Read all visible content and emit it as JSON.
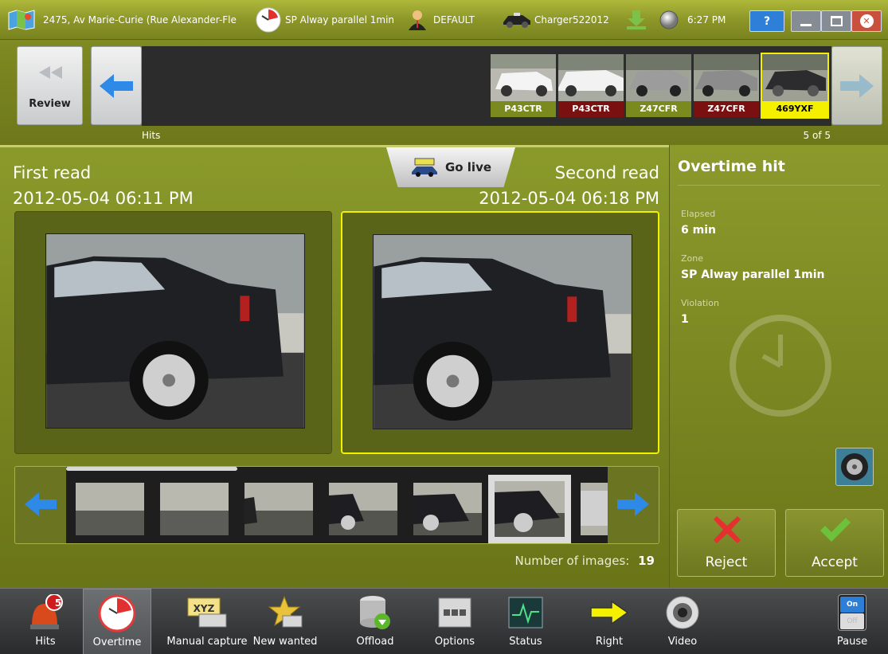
{
  "topbar": {
    "address": "2475, Av Marie-Curie  (Rue Alexander-Fle",
    "zone": "SP Alway parallel 1min",
    "profile": "DEFAULT",
    "vehicle": "Charger522012",
    "time": "6:27 PM",
    "help_label": "?"
  },
  "hits_strip": {
    "review_label": "Review",
    "caption": "Hits",
    "position": "5 of 5",
    "thumbs": [
      {
        "plate": "P43CTR",
        "label_color": "#7a8a1e"
      },
      {
        "plate": "P43CTR",
        "label_color": "#7a1010"
      },
      {
        "plate": "Z47CFR",
        "label_color": "#7a8a1e"
      },
      {
        "plate": "Z47CFR",
        "label_color": "#7a1010"
      },
      {
        "plate": "469YXF",
        "label_color": "#f5f000"
      }
    ]
  },
  "main": {
    "first_read_label": "First read",
    "first_read_date": "2012-05-04 06:11 PM",
    "second_read_label": "Second read",
    "second_read_date": "2012-05-04 06:18 PM",
    "go_live_label": "Go live",
    "number_of_images_label": "Number of images:",
    "number_of_images": "19"
  },
  "side": {
    "title": "Overtime hit",
    "elapsed_label": "Elapsed",
    "elapsed_value": "6 min",
    "zone_label": "Zone",
    "zone_value": "SP Alway parallel 1min",
    "violation_label": "Violation",
    "violation_value": "1",
    "reject_label": "Reject",
    "accept_label": "Accept"
  },
  "toolbar": {
    "hits_badge": "5",
    "items": [
      {
        "label": "Hits",
        "icon": "alarm-bell-icon"
      },
      {
        "label": "Overtime",
        "icon": "overtime-clock-icon"
      },
      {
        "label": "Manual capture",
        "icon": "plate-keyboard-icon"
      },
      {
        "label": "New wanted",
        "icon": "sheriff-badge-icon"
      },
      {
        "label": "Offload",
        "icon": "database-download-icon"
      },
      {
        "label": "Options",
        "icon": "options-panel-icon"
      },
      {
        "label": "Status",
        "icon": "status-monitor-icon"
      },
      {
        "label": "Right",
        "icon": "right-arrow-icon"
      },
      {
        "label": "Video",
        "icon": "camera-lens-icon"
      },
      {
        "label": "Pause",
        "icon": "on-off-switch-icon"
      }
    ],
    "pause_on": "On",
    "pause_off": "Off"
  },
  "colors": {
    "olive": "#8a9427",
    "plate_highlight": "#f5f000",
    "selected_frame": "#f0f000",
    "reject": "#e53030",
    "accept": "#6cc23a"
  }
}
